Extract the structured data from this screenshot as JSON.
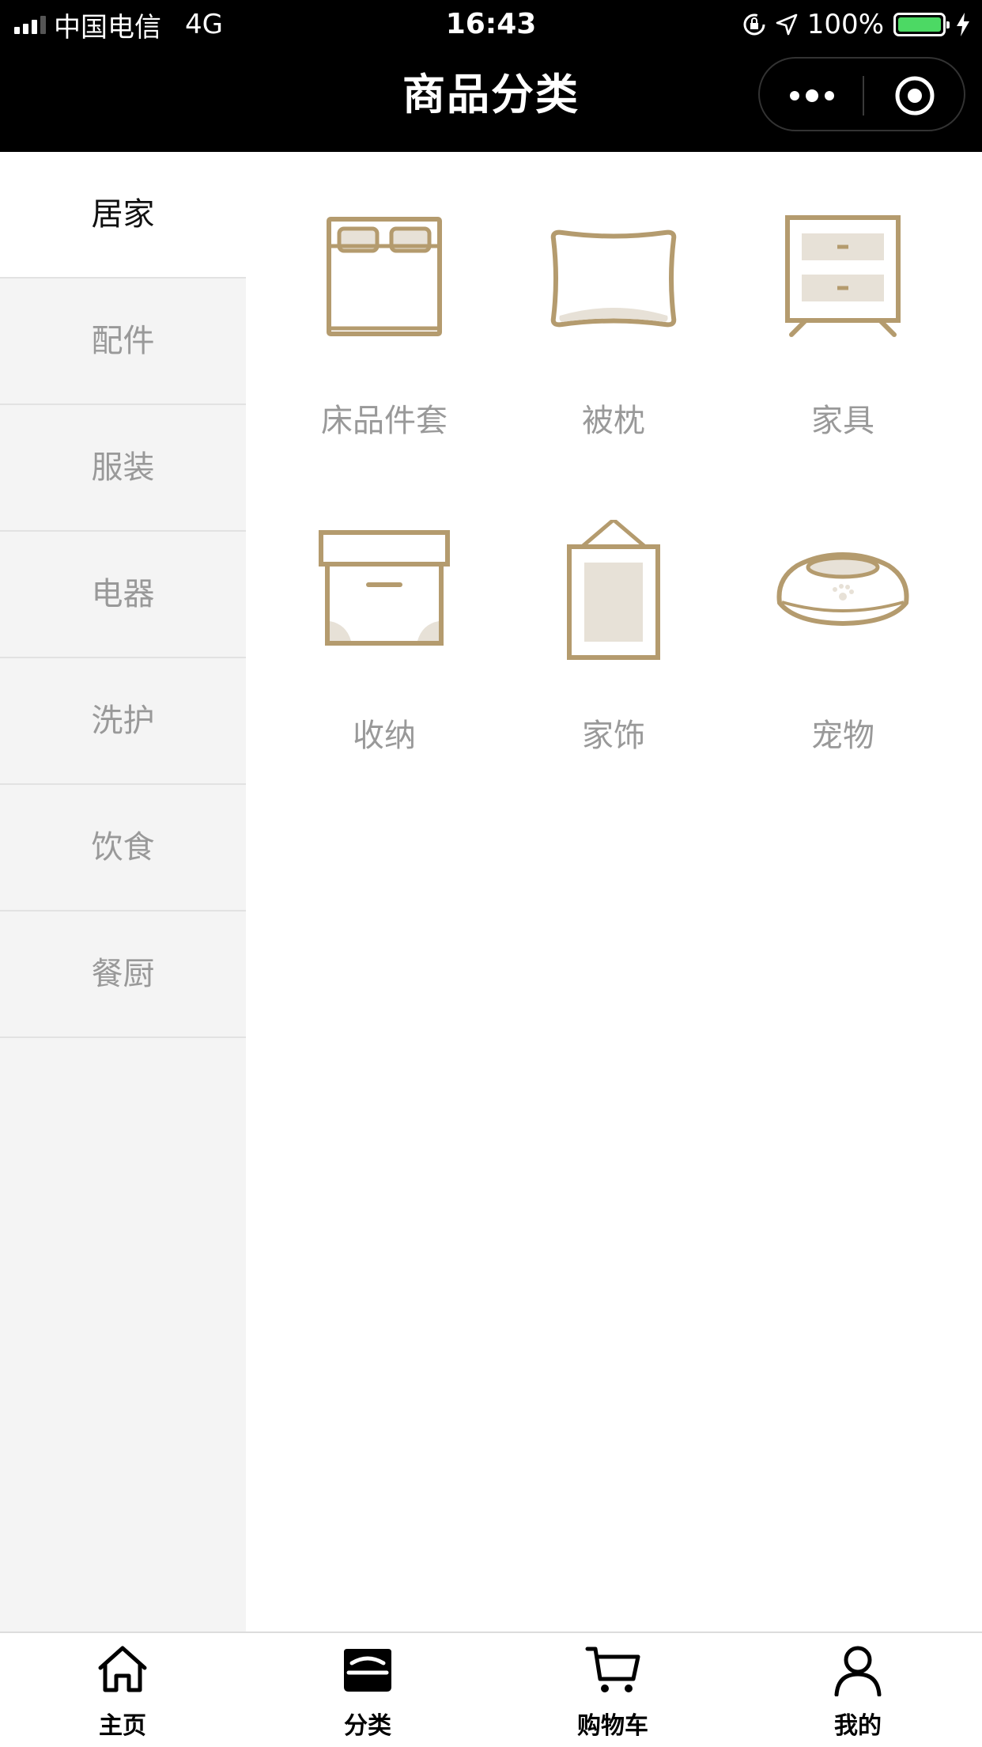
{
  "status_bar": {
    "carrier": "中国电信",
    "network": "4G",
    "time": "16:43",
    "battery_percent": "100%",
    "battery_level": 1.0
  },
  "nav": {
    "title": "商品分类",
    "more_icon": "more-dots-icon",
    "close_icon": "target-circle-icon"
  },
  "sidebar": {
    "active_index": 0,
    "items": [
      {
        "label": "居家"
      },
      {
        "label": "配件"
      },
      {
        "label": "服装"
      },
      {
        "label": "电器"
      },
      {
        "label": "洗护"
      },
      {
        "label": "饮食"
      },
      {
        "label": "餐厨"
      }
    ]
  },
  "categories": [
    {
      "label": "床品件套",
      "icon": "bed-icon"
    },
    {
      "label": "被枕",
      "icon": "pillow-icon"
    },
    {
      "label": "家具",
      "icon": "nightstand-icon"
    },
    {
      "label": "收纳",
      "icon": "storage-box-icon"
    },
    {
      "label": "家饰",
      "icon": "picture-frame-icon"
    },
    {
      "label": "宠物",
      "icon": "pet-bowl-icon"
    }
  ],
  "colors": {
    "accent": "#b49b6e",
    "accent_fill": "#e7e1d7",
    "sidebar_bg": "#f4f4f4",
    "text_muted": "#999999"
  },
  "tabbar": {
    "active_index": 1,
    "items": [
      {
        "label": "主页",
        "icon": "home-icon"
      },
      {
        "label": "分类",
        "icon": "category-icon"
      },
      {
        "label": "购物车",
        "icon": "cart-icon"
      },
      {
        "label": "我的",
        "icon": "user-icon"
      }
    ]
  }
}
